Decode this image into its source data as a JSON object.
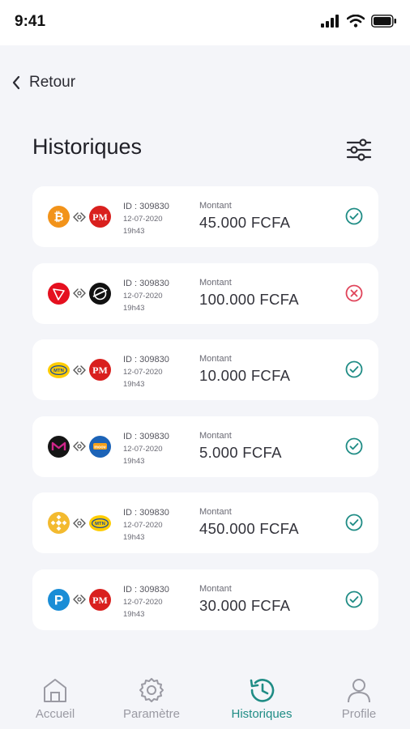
{
  "status_bar": {
    "time": "9:41"
  },
  "header": {
    "back_label": "Retour",
    "title": "Historiques"
  },
  "transactions": [
    {
      "from": "bitcoin-icon",
      "to": "perfect-money-icon",
      "id": "ID : 309830",
      "date": "12-07-2020",
      "time": "19h43",
      "amount_label": "Montant",
      "amount": "45.000 FCFA",
      "status": "success"
    },
    {
      "from": "tron-icon",
      "to": "stellar-icon",
      "id": "ID : 309830",
      "date": "12-07-2020",
      "time": "19h43",
      "amount_label": "Montant",
      "amount": "100.000 FCFA",
      "status": "failed"
    },
    {
      "from": "mtn-icon",
      "to": "perfect-money-icon",
      "id": "ID : 309830",
      "date": "12-07-2020",
      "time": "19h43",
      "amount_label": "Montant",
      "amount": "10.000 FCFA",
      "status": "success"
    },
    {
      "from": "monero-icon",
      "to": "moov-money-icon",
      "id": "ID : 309830",
      "date": "12-07-2020",
      "time": "19h43",
      "amount_label": "Montant",
      "amount": "5.000 FCFA",
      "status": "success"
    },
    {
      "from": "binance-icon",
      "to": "mtn-icon",
      "id": "ID : 309830",
      "date": "12-07-2020",
      "time": "19h43",
      "amount_label": "Montant",
      "amount": "450.000 FCFA",
      "status": "success"
    },
    {
      "from": "payeer-icon",
      "to": "perfect-money-icon",
      "id": "ID : 309830",
      "date": "12-07-2020",
      "time": "19h43",
      "amount_label": "Montant",
      "amount": "30.000 FCFA",
      "status": "success"
    }
  ],
  "tabbar": {
    "items": [
      {
        "label": "Accueil",
        "icon": "home-icon"
      },
      {
        "label": "Paramètre",
        "icon": "gear-icon"
      },
      {
        "label": "Historiques",
        "icon": "history-icon",
        "active": true
      },
      {
        "label": "Profile",
        "icon": "user-icon"
      }
    ]
  },
  "colors": {
    "accent": "#1f8c85",
    "success": "#1f8c85",
    "failed": "#e0445a",
    "background": "#f4f5f9"
  }
}
